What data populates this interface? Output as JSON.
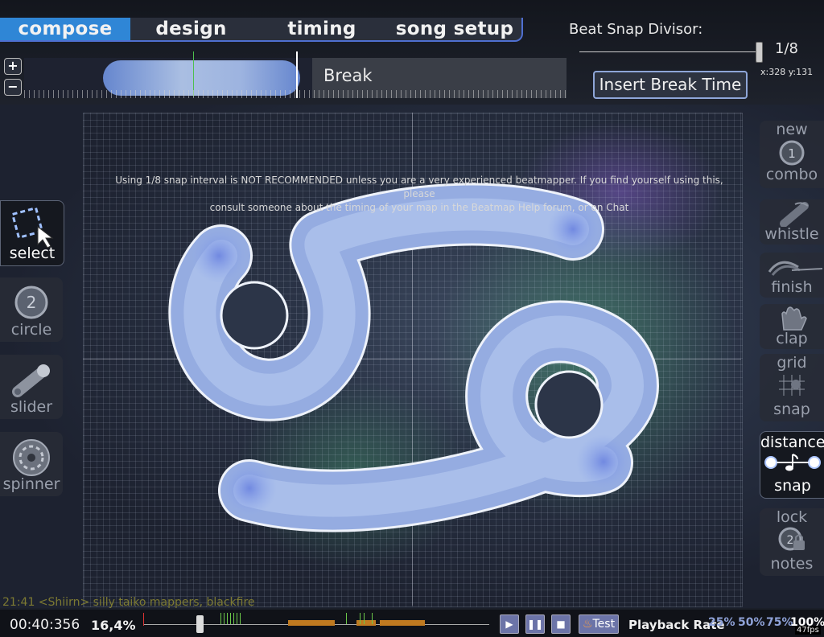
{
  "tabs": {
    "compose": "compose",
    "design": "design",
    "timing": "timing",
    "song_setup": "song setup"
  },
  "beat_snap": {
    "label": "Beat Snap Divisor:",
    "value": "1/8"
  },
  "cursor_readout": "x:328 y:131",
  "zoom": {
    "in": "+",
    "out": "−"
  },
  "timeline": {
    "break_label": "Break"
  },
  "insert_break_label": "Insert Break Time",
  "warning": {
    "line1": "Using 1/8 snap interval is NOT RECOMMENDED unless you are a very experienced beatmapper.  If you find yourself using this, please",
    "line2": "consult someone about the timing of your map in the Beatmap Help forum, or on Chat"
  },
  "tools": {
    "select": "select",
    "circle": "circle",
    "slider": "slider",
    "spinner": "spinner",
    "circle_number": "2"
  },
  "toggles": {
    "new_combo_top": "new",
    "new_combo_bottom": "combo",
    "whistle": "whistle",
    "finish": "finish",
    "clap": "clap",
    "grid_top": "grid",
    "grid_bottom": "snap",
    "distance_top": "distance",
    "distance_bottom": "snap",
    "lock_top": "lock",
    "lock_bottom": "notes"
  },
  "chat_line": "21:41 <Shiirn> silly taiko mappers, blackfire",
  "playback": {
    "time": "00:40:356",
    "percent": "16,4%",
    "test": "Test",
    "rate_label": "Playback Rate",
    "rates": [
      "25%",
      "50%",
      "75%",
      "100%"
    ],
    "fps": "47fps"
  },
  "colors": {
    "accent": "#2f86d6",
    "slider_body": "#b6ccf2",
    "break_marker": "#c07a20",
    "kiai": "#6cc94a"
  }
}
